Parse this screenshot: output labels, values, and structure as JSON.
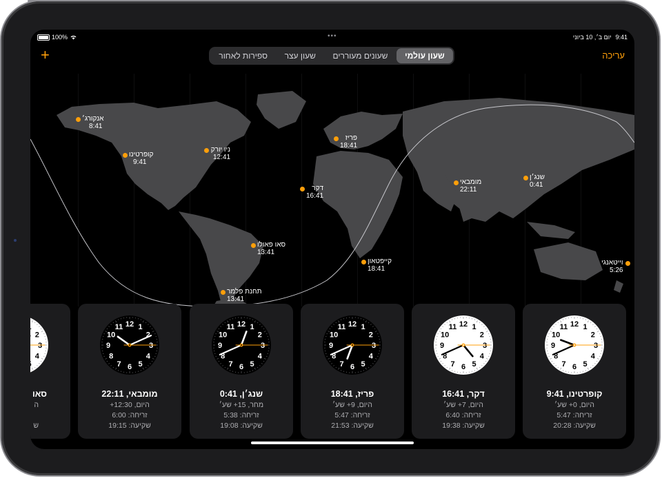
{
  "status": {
    "time": "9:41",
    "date": "יום ב׳, 10 ביוני",
    "battery": "100%"
  },
  "nav": {
    "edit": "עריכה",
    "add": "+"
  },
  "tabs": [
    {
      "label": "שעון עולמי",
      "active": true
    },
    {
      "label": "שעונים מעוררים",
      "active": false
    },
    {
      "label": "שעון עצר",
      "active": false
    },
    {
      "label": "ספירות לאחור",
      "active": false
    }
  ],
  "map_cities": [
    {
      "name": "אנקורג׳",
      "time": "8:41"
    },
    {
      "name": "קופרטינו",
      "time": "9:41"
    },
    {
      "name": "ניו יורק",
      "time": "12:41"
    },
    {
      "name": "פריז",
      "time": "18:41"
    },
    {
      "name": "דקר",
      "time": "16:41"
    },
    {
      "name": "מומבאי",
      "time": "22:11"
    },
    {
      "name": "שנג׳ן",
      "time": "0:41"
    },
    {
      "name": "סאו פאולו",
      "time": "13:41"
    },
    {
      "name": "קייפטאון",
      "time": "18:41"
    },
    {
      "name": "וייטאנגי",
      "time": "5:26"
    },
    {
      "name": "תחנת פלמר",
      "time": "13:41"
    }
  ],
  "cards": [
    {
      "title": "קופרטינו, 9:41",
      "offset": "היום, 0+ שע׳",
      "sunrise": "זריחה: 5:47",
      "sunset": "שקיעה: 20:28",
      "hour": 9,
      "minute": 41,
      "second": 15,
      "theme": "light"
    },
    {
      "title": "דקר, 16:41",
      "offset": "היום, 7+ שע׳",
      "sunrise": "זריחה: 6:40",
      "sunset": "שקיעה: 19:38",
      "hour": 16,
      "minute": 41,
      "second": 15,
      "theme": "light"
    },
    {
      "title": "פריז, 18:41",
      "offset": "היום, 9+ שע׳",
      "sunrise": "זריחה: 5:47",
      "sunset": "שקיעה: 21:53",
      "hour": 18,
      "minute": 41,
      "second": 15,
      "theme": "dark"
    },
    {
      "title": "שנג׳ן, 0:41",
      "offset": "מחר, 15+ שע׳",
      "sunrise": "זריחה: 5:38",
      "sunset": "שקיעה: 19:08",
      "hour": 0,
      "minute": 41,
      "second": 15,
      "theme": "dark"
    },
    {
      "title": "מומבאי, 22:11",
      "offset": "היום, 12:30+",
      "sunrise": "זריחה: 6:00",
      "sunset": "שקיעה: 19:15",
      "hour": 22,
      "minute": 11,
      "second": 15,
      "theme": "dark"
    },
    {
      "title": "סאו",
      "offset": "ה",
      "sunrise": "",
      "sunset": "ש",
      "hour": 13,
      "minute": 41,
      "second": 15,
      "theme": "light"
    }
  ],
  "clock_numerals": [
    "12",
    "1",
    "2",
    "3",
    "4",
    "5",
    "6",
    "7",
    "8",
    "9",
    "10",
    "11"
  ],
  "colors": {
    "accent": "#ff9f0a",
    "card_bg": "#1c1c1e",
    "land": "#4a4a4c",
    "night": "#2a2a2c"
  }
}
